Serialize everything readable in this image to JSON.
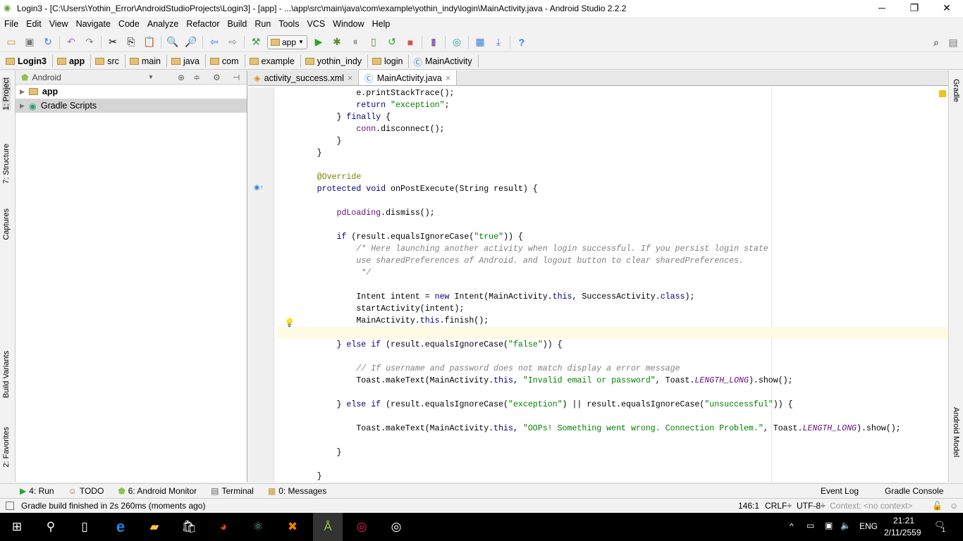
{
  "window": {
    "title": "Login3 - [C:\\Users\\Yothin_Error\\AndroidStudioProjects\\Login3] - [app] - ...\\app\\src\\main\\java\\com\\example\\yothin_indy\\login\\MainActivity.java - Android Studio 2.2.2"
  },
  "menu": [
    "File",
    "Edit",
    "View",
    "Navigate",
    "Code",
    "Analyze",
    "Refactor",
    "Build",
    "Run",
    "Tools",
    "VCS",
    "Window",
    "Help"
  ],
  "toolbar": {
    "run_config": "app"
  },
  "breadcrumbs": [
    "Login3",
    "app",
    "src",
    "main",
    "java",
    "com",
    "example",
    "yothin_indy",
    "login",
    "MainActivity"
  ],
  "left_tabs": [
    "1: Project",
    "7: Structure",
    "Captures",
    "Build Variants",
    "2: Favorites"
  ],
  "right_tabs": [
    "Gradle",
    "Android Model"
  ],
  "project": {
    "view": "Android",
    "items": [
      "app",
      "Gradle Scripts"
    ]
  },
  "editor": {
    "tabs": [
      "activity_success.xml",
      "MainActivity.java"
    ],
    "active_tab": 1,
    "lines": [
      [
        [
          "",
          "                "
        ],
        [
          "",
          "e.printStackTrace();"
        ]
      ],
      [
        [
          "",
          "                "
        ],
        [
          "kw",
          "return "
        ],
        [
          "str",
          "\"exception\""
        ],
        [
          "",
          ";"
        ]
      ],
      [
        [
          "",
          "            } "
        ],
        [
          "kw",
          "finally"
        ],
        [
          "",
          " {"
        ]
      ],
      [
        [
          "",
          "                "
        ],
        [
          "fld",
          "conn"
        ],
        [
          "",
          ".disconnect();"
        ]
      ],
      [
        [
          "",
          "            }"
        ]
      ],
      [
        [
          "",
          "        }"
        ]
      ],
      [],
      [
        [
          "",
          "        "
        ],
        [
          "ann",
          "@Override"
        ]
      ],
      [
        [
          "",
          "        "
        ],
        [
          "kw",
          "protected void "
        ],
        [
          "",
          "onPostExecute(String result) {"
        ]
      ],
      [],
      [
        [
          "",
          "            "
        ],
        [
          "fld",
          "pdLoading"
        ],
        [
          "",
          ".dismiss();"
        ]
      ],
      [],
      [
        [
          "",
          "            "
        ],
        [
          "kw",
          "if "
        ],
        [
          "",
          "(result.equalsIgnoreCase("
        ],
        [
          "str",
          "\"true\""
        ],
        [
          "",
          ")) {"
        ]
      ],
      [
        [
          "",
          "                "
        ],
        [
          "cmt",
          "/* Here launching another activity when login successful. If you persist login state"
        ]
      ],
      [
        [
          "",
          "                "
        ],
        [
          "cmt",
          "use sharedPreferences of Android. and logout button to clear sharedPreferences."
        ]
      ],
      [
        [
          "",
          "                "
        ],
        [
          "cmt",
          " */"
        ]
      ],
      [],
      [
        [
          "",
          "                Intent intent = "
        ],
        [
          "kw",
          "new "
        ],
        [
          "",
          "Intent(MainActivity."
        ],
        [
          "kw",
          "this"
        ],
        [
          "",
          ", SuccessActivity."
        ],
        [
          "kw",
          "class"
        ],
        [
          "",
          ");"
        ]
      ],
      [
        [
          "",
          "                startActivity(intent);"
        ]
      ],
      [
        [
          "",
          "                MainActivity."
        ],
        [
          "kw",
          "this"
        ],
        [
          "",
          ".finish();"
        ]
      ],
      [],
      [
        [
          "",
          "            } "
        ],
        [
          "kw",
          "else if "
        ],
        [
          "",
          "(result.equalsIgnoreCase("
        ],
        [
          "str",
          "\"false\""
        ],
        [
          "",
          ")) {"
        ]
      ],
      [],
      [
        [
          "",
          "                "
        ],
        [
          "cmt",
          "// If username and password does not match display a error message"
        ]
      ],
      [
        [
          "",
          "                Toast.makeText(MainActivity."
        ],
        [
          "kw",
          "this"
        ],
        [
          "",
          ", "
        ],
        [
          "str",
          "\"Invalid email or password\""
        ],
        [
          "",
          ", Toast."
        ],
        [
          "cst",
          "LENGTH_LONG"
        ],
        [
          "",
          ").show();"
        ]
      ],
      [],
      [
        [
          "",
          "            } "
        ],
        [
          "kw",
          "else if "
        ],
        [
          "",
          "(result.equalsIgnoreCase("
        ],
        [
          "str",
          "\"exception\""
        ],
        [
          "",
          ") || result.equalsIgnoreCase("
        ],
        [
          "str",
          "\"unsuccessful\""
        ],
        [
          "",
          ")) {"
        ]
      ],
      [],
      [
        [
          "",
          "                Toast.makeText(MainActivity."
        ],
        [
          "kw",
          "this"
        ],
        [
          "",
          ", "
        ],
        [
          "str",
          "\"OOPs! Something went wrong. Connection Problem.\""
        ],
        [
          "",
          ", Toast."
        ],
        [
          "cst",
          "LENGTH_LONG"
        ],
        [
          "",
          ").show();"
        ]
      ],
      [],
      [
        [
          "",
          "            }"
        ]
      ],
      [],
      [
        [
          "",
          "        }"
        ]
      ]
    ],
    "current_line_index": 20
  },
  "bottom_tabs": [
    "4: Run",
    "TODO",
    "6: Android Monitor",
    "Terminal",
    "0: Messages"
  ],
  "bottom_right_tabs": [
    "Event Log",
    "Gradle Console"
  ],
  "status": {
    "message": "Gradle build finished in 2s 260ms (moments ago)",
    "position": "146:1",
    "line_sep": "CRLF÷",
    "encoding": "UTF-8÷",
    "context": "Context: <no context>"
  },
  "taskbar": {
    "language": "ENG",
    "time": "21:21",
    "date": "2/11/2559",
    "notifications": "1"
  }
}
